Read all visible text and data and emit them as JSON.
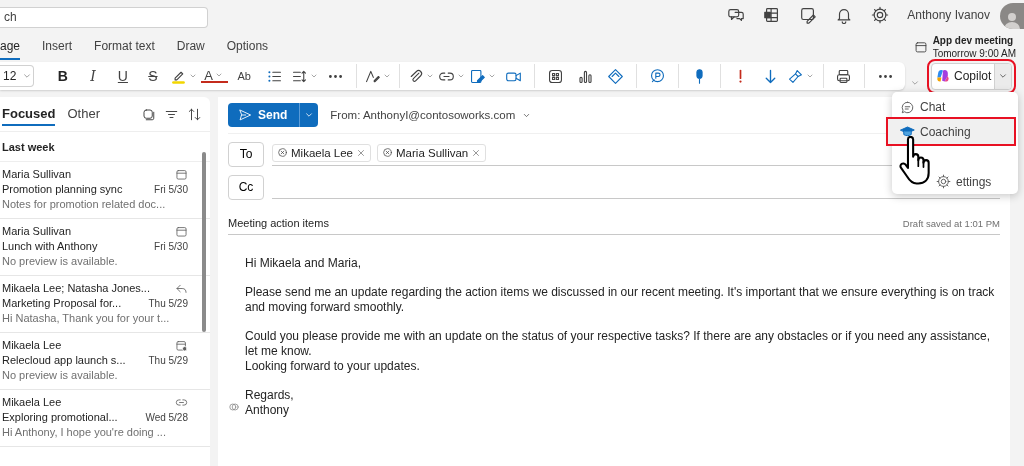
{
  "search": {
    "value": "ch"
  },
  "user": {
    "name": "Anthony Ivanov"
  },
  "ribbon_tabs": [
    {
      "label": "age",
      "selected": true
    },
    {
      "label": "Insert",
      "selected": false
    },
    {
      "label": "Format text",
      "selected": false
    },
    {
      "label": "Draw",
      "selected": false
    },
    {
      "label": "Options",
      "selected": false
    }
  ],
  "upcoming": {
    "title": "App dev meeting",
    "time": "Tomorrow 9:00 AM"
  },
  "toolbar": {
    "font_size": "12",
    "items": [
      {
        "kind": "bold",
        "glyph": "B",
        "dropdown": false
      },
      {
        "kind": "italic",
        "glyph": "I",
        "dropdown": false
      },
      {
        "kind": "underline",
        "glyph": "U",
        "dropdown": false
      },
      {
        "kind": "strikethrough",
        "glyph": "S",
        "dropdown": false
      },
      {
        "kind": "highlight",
        "dropdown": true
      },
      {
        "kind": "font-color",
        "glyph": "A",
        "dropdown": true
      },
      {
        "kind": "spelling",
        "glyph": "Ab",
        "dropdown": false
      },
      {
        "kind": "bullets",
        "dropdown": false
      },
      {
        "kind": "spacing",
        "dropdown": true
      },
      {
        "kind": "more",
        "dropdown": false
      },
      {
        "kind": "separator"
      },
      {
        "kind": "styles",
        "dropdown": true
      },
      {
        "kind": "separator"
      },
      {
        "kind": "attach",
        "dropdown": true
      },
      {
        "kind": "link",
        "dropdown": true
      },
      {
        "kind": "signature",
        "dropdown": true
      },
      {
        "kind": "video",
        "dropdown": false
      },
      {
        "kind": "separator"
      },
      {
        "kind": "apps",
        "dropdown": false
      },
      {
        "kind": "chart",
        "dropdown": false
      },
      {
        "kind": "sticker",
        "dropdown": false
      },
      {
        "kind": "separator"
      },
      {
        "kind": "loop",
        "dropdown": false
      },
      {
        "kind": "separator"
      },
      {
        "kind": "dictate",
        "dropdown": false
      },
      {
        "kind": "separator"
      },
      {
        "kind": "important",
        "dropdown": false
      },
      {
        "kind": "low",
        "dropdown": false
      },
      {
        "kind": "sweep",
        "dropdown": true
      },
      {
        "kind": "separator"
      },
      {
        "kind": "print",
        "dropdown": false
      },
      {
        "kind": "separator"
      },
      {
        "kind": "more",
        "dropdown": false
      }
    ]
  },
  "copilot": {
    "label": "Copilot",
    "highlighted": true
  },
  "copilot_menu": {
    "items": [
      {
        "kind": "chat",
        "label": "Chat",
        "highlighted": false
      },
      {
        "kind": "coaching",
        "label": "Coaching",
        "highlighted": true
      },
      {
        "kind": "settings",
        "label": "ettings",
        "highlighted": false
      }
    ]
  },
  "mail_list": {
    "tabs": [
      {
        "label": "Focused",
        "selected": true
      },
      {
        "label": "Other",
        "selected": false
      }
    ],
    "group": "Last week",
    "items": [
      {
        "sender": "Maria Sullivan",
        "subject": "Promotion planning sync",
        "date": "Fri 5/30",
        "preview": "Notes for promotion related doc...",
        "kind": "event"
      },
      {
        "sender": "Maria Sullivan",
        "subject": "Lunch with Anthony",
        "date": "Fri 5/30",
        "preview": "No preview is available.",
        "kind": "event"
      },
      {
        "sender": "Mikaela Lee; Natasha Jones...",
        "subject": "Marketing Proposal for...",
        "date": "Thu 5/29",
        "preview": "Hi Natasha, Thank you for your t...",
        "kind": "reply"
      },
      {
        "sender": "Mikaela Lee",
        "subject": "Relecloud app launch s...",
        "date": "Thu 5/29",
        "preview": "No preview is available.",
        "kind": "accepted"
      },
      {
        "sender": "Mikaela Lee",
        "subject": "Exploring promotional...",
        "date": "Wed 5/28",
        "preview": "Hi Anthony, I hope you're doing ...",
        "kind": "link"
      }
    ]
  },
  "compose": {
    "send": "Send",
    "from": "From: AnthonyI@contosoworks.com",
    "to_label": "To",
    "recipients": [
      "Mikaela Lee",
      "Maria Sullivan"
    ],
    "cc_label": "Cc",
    "subject": "Meeting action items",
    "draft_status": "Draft saved at 1:01 PM",
    "body": [
      [
        "Hi Mikaela and Maria,"
      ],
      [
        "Please send me an update regarding the action items we discussed in our recent meeting. It's important that we ensure everything is on track and moving forward smoothly."
      ],
      [
        "Could you please provide me with an update on the status of your respective tasks? If there are any obstacles or if you need any assistance, let me know.",
        "Looking forward to your updates."
      ],
      [
        "Regards,",
        "Anthony"
      ]
    ]
  }
}
